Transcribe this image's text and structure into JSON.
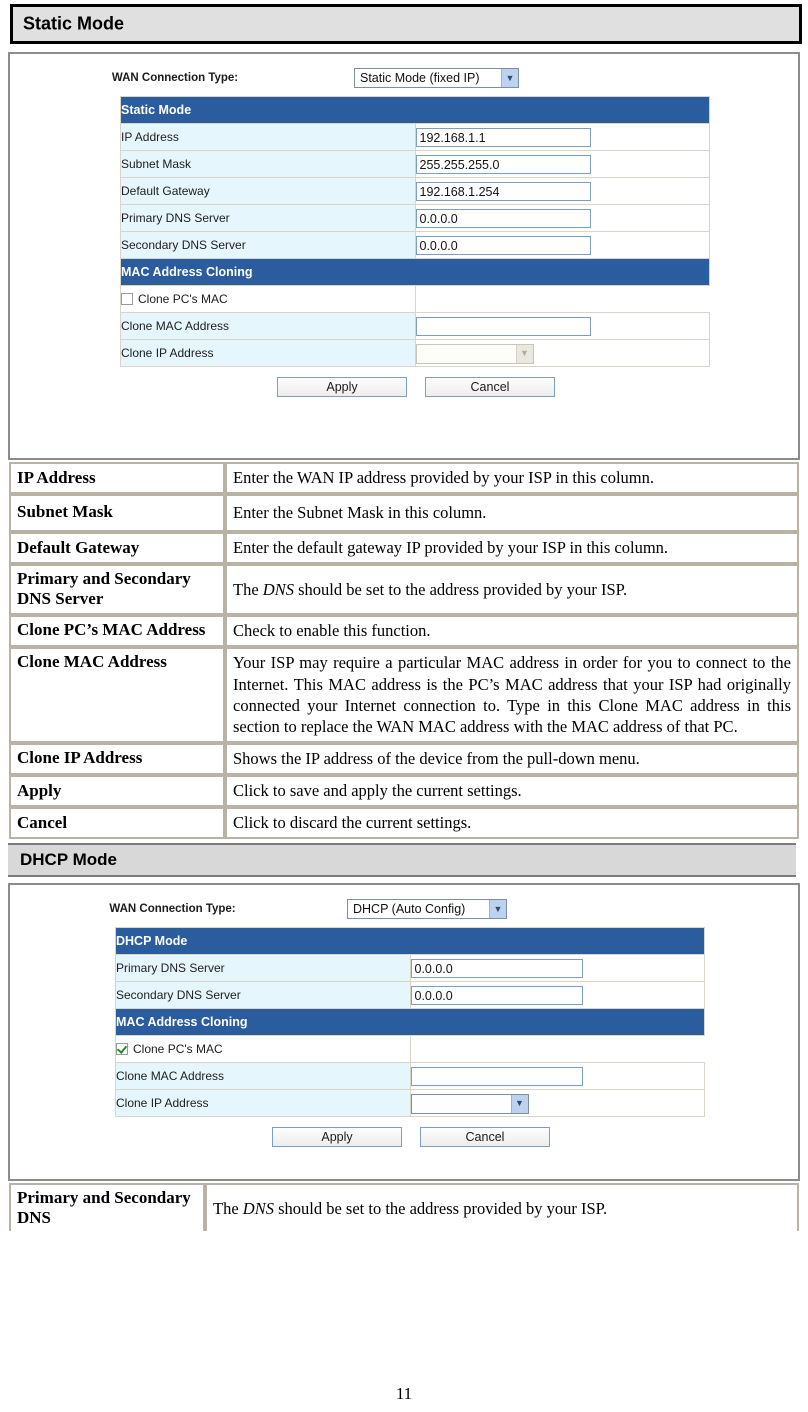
{
  "page_number": "11",
  "sections": [
    {
      "title": "Static Mode",
      "screenshot": {
        "wan_label": "WAN Connection Type:",
        "wan_select": {
          "value": "Static Mode (fixed IP)",
          "arrow_icon": "chevron-down-icon"
        },
        "group_header": "Static Mode",
        "rows": [
          {
            "label": "IP Address",
            "value": "192.168.1.1"
          },
          {
            "label": "Subnet Mask",
            "value": "255.255.255.0"
          },
          {
            "label": "Default Gateway",
            "value": "192.168.1.254"
          },
          {
            "label": "Primary DNS Server",
            "value": "0.0.0.0"
          },
          {
            "label": "Secondary DNS Server",
            "value": "0.0.0.0"
          }
        ],
        "mac_header": "MAC Address Cloning",
        "clone_checkbox_label": "Clone PC's MAC",
        "clone_checkbox_checked": false,
        "clone_mac_label": "Clone MAC Address",
        "clone_mac_value": "",
        "clone_ip_label": "Clone IP Address",
        "clone_ip_value": "",
        "clone_ip_disabled": true,
        "apply_label": "Apply",
        "cancel_label": "Cancel"
      },
      "descriptions": [
        {
          "term": "IP Address",
          "desc": "Enter the WAN IP address provided by your ISP in this column."
        },
        {
          "term": "Subnet Mask",
          "desc": "Enter the Subnet Mask in this column."
        },
        {
          "term": "Default Gateway",
          "desc": "Enter the default gateway IP provided by your ISP in this column."
        },
        {
          "term": "Primary and Secondary DNS Server",
          "desc_pre": "The ",
          "desc_em": "DNS",
          "desc_post": " should be set to the address provided by your ISP."
        },
        {
          "term": "Clone PC’s MAC Address",
          "desc": "Check to enable this function."
        },
        {
          "term": "Clone MAC Address",
          "desc": "Your ISP may require a particular MAC address in order for you to connect to the Internet. This MAC address is the PC’s MAC address that your ISP had originally connected your Internet connection to. Type in this Clone MAC address in this section to replace the WAN MAC address with the MAC address of that PC."
        },
        {
          "term": "Clone IP Address",
          "desc": "Shows the IP address of the device from the pull-down menu."
        },
        {
          "term": "Apply",
          "desc": "Click to save and apply the current settings."
        },
        {
          "term": "Cancel",
          "desc": "Click to discard the current settings."
        }
      ]
    },
    {
      "title": "DHCP Mode",
      "screenshot": {
        "wan_label": "WAN Connection Type:",
        "wan_select": {
          "value": "DHCP (Auto Config)",
          "arrow_icon": "chevron-down-icon"
        },
        "group_header": "DHCP Mode",
        "rows": [
          {
            "label": "Primary DNS Server",
            "value": "0.0.0.0"
          },
          {
            "label": "Secondary DNS Server",
            "value": "0.0.0.0"
          }
        ],
        "mac_header": "MAC Address Cloning",
        "clone_checkbox_label": "Clone PC's MAC",
        "clone_checkbox_checked": true,
        "clone_mac_label": "Clone MAC Address",
        "clone_mac_value": "",
        "clone_ip_label": "Clone IP Address",
        "clone_ip_value": "",
        "clone_ip_disabled": false,
        "apply_label": "Apply",
        "cancel_label": "Cancel"
      },
      "descriptions": [
        {
          "term": "Primary and Secondary DNS",
          "desc_pre": "The ",
          "desc_em": "DNS",
          "desc_post": " should be set to the address provided by your ISP."
        }
      ]
    }
  ],
  "colors": {
    "group_header_blue": "#2b5c9e",
    "label_cell": "#e6f6fd",
    "section_band": "#e0e0e0",
    "table_border": "#b9b3a5"
  }
}
